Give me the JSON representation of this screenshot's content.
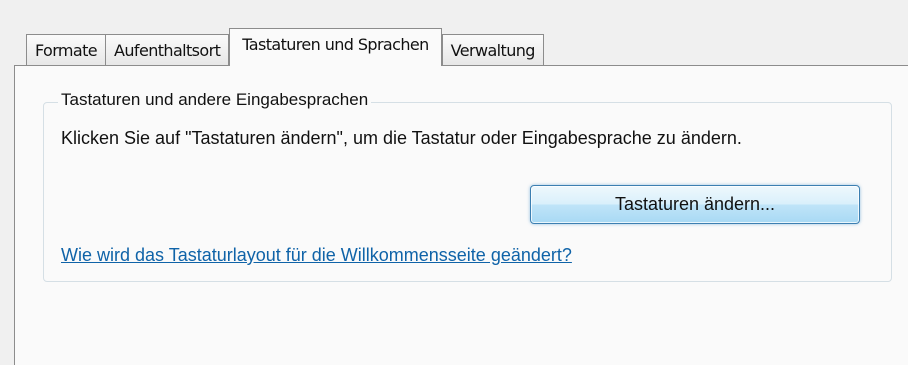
{
  "tabs": [
    {
      "label": "Formate",
      "active": false
    },
    {
      "label": "Aufenthaltsort",
      "active": false
    },
    {
      "label": "Tastaturen und Sprachen",
      "active": true
    },
    {
      "label": "Verwaltung",
      "active": false
    }
  ],
  "group": {
    "title": "Tastaturen und andere Eingabesprachen",
    "description": "Klicken Sie auf \"Tastaturen ändern\", um die Tastatur oder Eingabesprache zu ändern.",
    "button_label": "Tastaturen ändern...",
    "link_text": "Wie wird das Tastaturlayout für die Willkommensseite geändert?"
  },
  "colors": {
    "link": "#0f63a8",
    "button_border": "#3c7fb1",
    "window_background": "#f0f0f0",
    "panel_background": "#fafafa"
  }
}
